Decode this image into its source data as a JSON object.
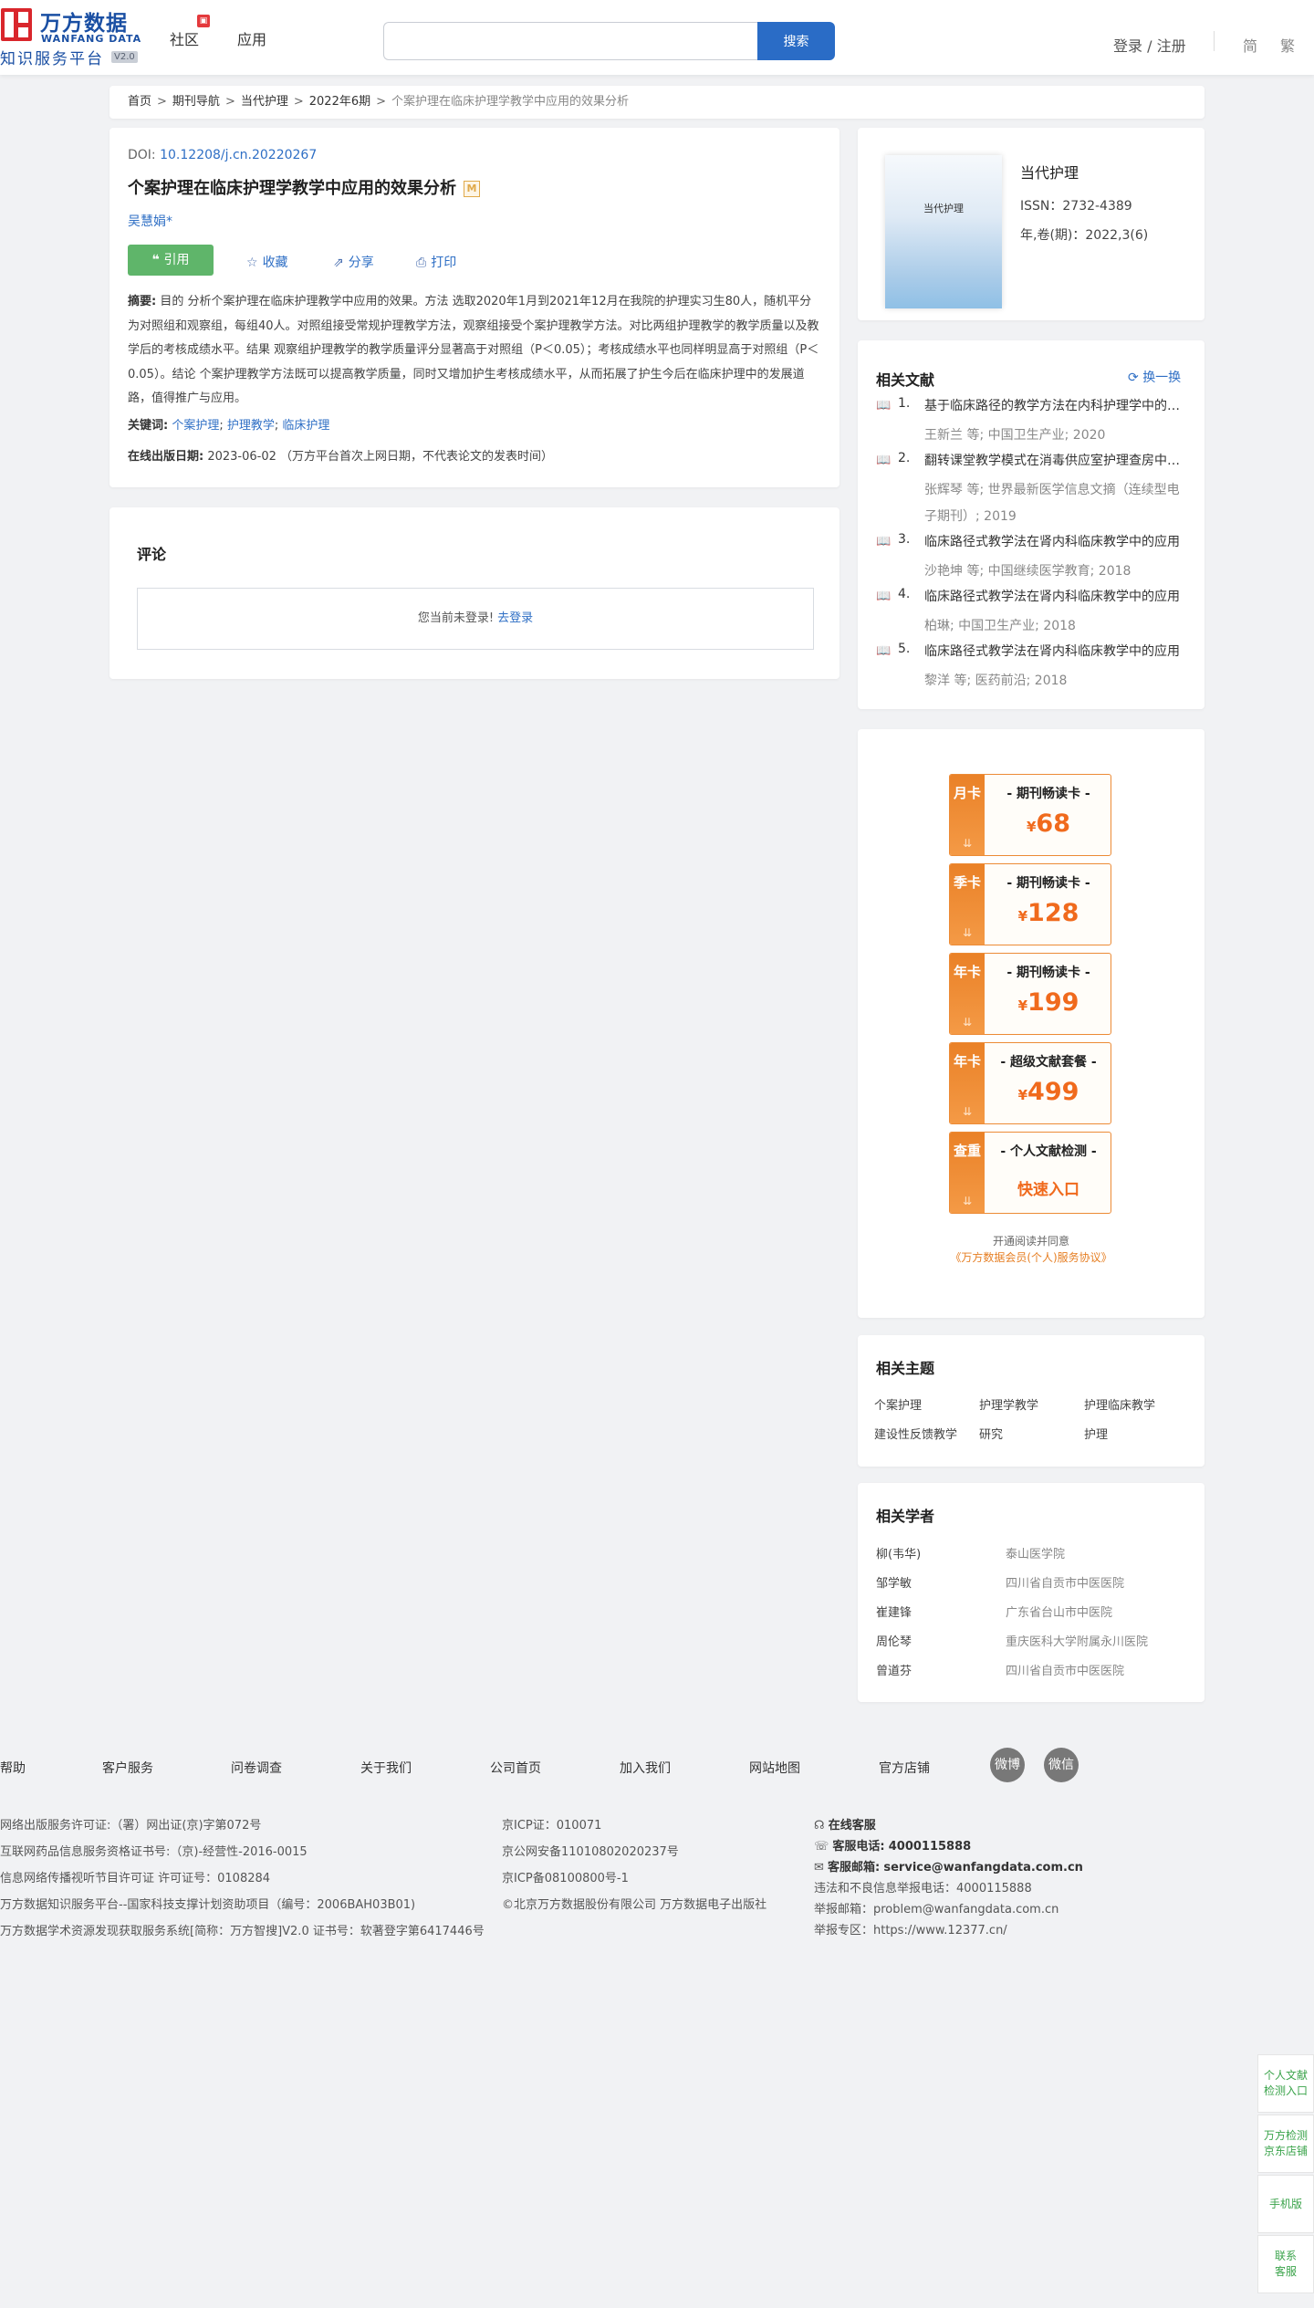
{
  "header": {
    "logo_cn": "万方数据",
    "logo_en": "WANFANG DATA",
    "logo_sub": "知识服务平台",
    "logo_ver": "V2.0",
    "nav_community": "社区",
    "nav_apps": "应用",
    "search_placeholder": "",
    "search_button": "搜索",
    "login": "登录 / 注册",
    "lang_simplified": "简",
    "lang_traditional": "繁"
  },
  "breadcrumb": {
    "items": [
      "首页",
      "期刊导航",
      "当代护理",
      "2022年6期"
    ],
    "current": "个案护理在临床护理学教学中应用的效果分析"
  },
  "article": {
    "doi_label": "DOI:",
    "doi": "10.12208/j.cn.20220267",
    "title": "个案护理在临床护理学教学中应用的效果分析",
    "title_badge": "M",
    "author": "吴慧娟*",
    "cite": "引用",
    "favorite": "收藏",
    "share": "分享",
    "print": "打印",
    "abstract_label": "摘要:",
    "abstract": "目的 分析个案护理在临床护理教学中应用的效果。方法 选取2020年1月到2021年12月在我院的护理实习生80人，随机平分为对照组和观察组，每组40人。对照组接受常规护理教学方法，观察组接受个案护理教学方法。对比两组护理教学的教学质量以及教学后的考核成绩水平。结果 观察组护理教学的教学质量评分显著高于对照组（P＜0.05）；考核成绩水平也同样明显高于对照组（P＜0.05）。结论 个案护理教学方法既可以提高教学质量，同时又增加护生考核成绩水平，从而拓展了护生今后在临床护理中的发展道路，值得推广与应用。",
    "keywords_label": "关键词:",
    "keywords": [
      "个案护理",
      "护理教学",
      "临床护理"
    ],
    "pubdate_label": "在线出版日期:",
    "pubdate": "2023-06-02",
    "pubdate_note": "（万方平台首次上网日期，不代表论文的发表时间）"
  },
  "comment": {
    "title": "评论",
    "not_logged": "您当前未登录!",
    "go_login": "去登录"
  },
  "journal": {
    "cover_text": "当代护理",
    "name": "当代护理",
    "issn": "ISSN：2732-4389",
    "year_vol": "年,卷(期)：2022,3(6)"
  },
  "related_docs": {
    "title": "相关文献",
    "refresh": "换一换",
    "items": [
      {
        "num": "1.",
        "title": "基于临床路径的教学方法在内科护理学中的应用",
        "meta": "王新兰 等; 中国卫生产业; 2020"
      },
      {
        "num": "2.",
        "title": "翻转课堂教学模式在消毒供应室护理查房中的应用",
        "meta": "张辉琴 等; 世界最新医学信息文摘（连续型电子期刊）; 2019"
      },
      {
        "num": "3.",
        "title": "临床路径式教学法在肾内科临床教学中的应用",
        "meta": "沙艳坤 等; 中国继续医学教育; 2018"
      },
      {
        "num": "4.",
        "title": "临床路径式教学法在肾内科临床教学中的应用",
        "meta": "柏琳; 中国卫生产业; 2018"
      },
      {
        "num": "5.",
        "title": "临床路径式教学法在肾内科临床教学中的应用",
        "meta": "黎洋 等; 医药前沿; 2018"
      }
    ]
  },
  "packages": {
    "items": [
      {
        "tag": "月卡",
        "name": "- 期刊畅读卡 -",
        "price": "68"
      },
      {
        "tag": "季卡",
        "name": "- 期刊畅读卡 -",
        "price": "128"
      },
      {
        "tag": "年卡",
        "name": "- 期刊畅读卡 -",
        "price": "199"
      },
      {
        "tag": "年卡",
        "name": "- 超级文献套餐 -",
        "price": "499"
      },
      {
        "tag": "查重",
        "name": "- 个人文献检测 -",
        "enter": "快速入口"
      }
    ],
    "currency": "¥",
    "note": "开通阅读并同意",
    "agreement": "《万方数据会员(个人)服务协议》"
  },
  "topics": {
    "title": "相关主题",
    "items": [
      "个案护理",
      "护理学教学",
      "护理临床教学",
      "建设性反馈教学",
      "研究",
      "护理"
    ]
  },
  "scholars": {
    "title": "相关学者",
    "items": [
      {
        "name": "柳(韦华)",
        "org": "泰山医学院"
      },
      {
        "name": "邹学敏",
        "org": "四川省自贡市中医医院"
      },
      {
        "name": "崔建锋",
        "org": "广东省台山市中医院"
      },
      {
        "name": "周伦琴",
        "org": "重庆医科大学附属永川医院"
      },
      {
        "name": "曾道芬",
        "org": "四川省自贡市中医医院"
      }
    ]
  },
  "footer": {
    "links": [
      "帮助",
      "客户服务",
      "问卷调查",
      "关于我们",
      "公司首页",
      "加入我们",
      "网站地图",
      "官方店铺"
    ],
    "weibo": "微博",
    "wechat": "微信",
    "col1": [
      "网络出版服务许可证:（署）网出证(京)字第072号",
      "互联网药品信息服务资格证书号:（京)-经营性-2016-0015",
      "信息网络传播视听节目许可证 许可证号：0108284",
      "万方数据知识服务平台--国家科技支撑计划资助项目（编号：2006BAH03B01)",
      "万方数据学术资源发现获取服务系统[简称：万方智搜]V2.0 证书号：软著登字第6417446号"
    ],
    "col2": [
      "京ICP证：010071",
      "京公网安备11010802020237号",
      "京ICP备08100800号-1",
      "©北京万方数据股份有限公司 万方数据电子出版社"
    ],
    "online_service": "在线客服",
    "phone_label": "客服电话:",
    "phone": "4000115888",
    "email_label": "客服邮箱:",
    "email": "service@wanfangdata.com.cn",
    "report_phone": "违法和不良信息举报电话：4000115888",
    "report_email": "举报邮箱：problem@wanfangdata.com.cn",
    "report_zone": "举报专区：https://www.12377.cn/"
  },
  "side_widgets": [
    "个人文献检测入口",
    "万方检测京东店铺",
    "手机版",
    "联系客服"
  ]
}
